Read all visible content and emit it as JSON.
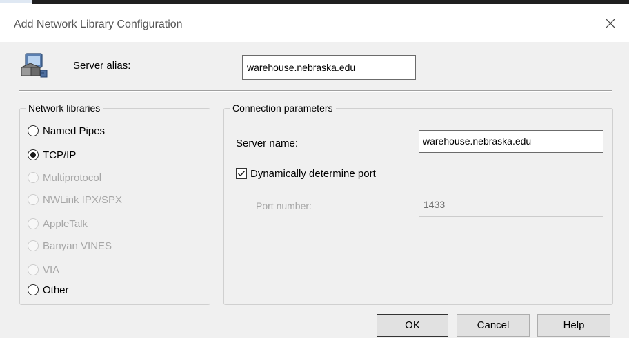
{
  "window": {
    "title": "Add Network Library Configuration",
    "close_icon": "close-icon"
  },
  "alias": {
    "icon": "server-network-icon",
    "label": "Server alias:",
    "value": "warehouse.nebraska.edu"
  },
  "network_libraries": {
    "title": "Network libraries",
    "options": [
      {
        "label": "Named Pipes",
        "checked": false,
        "enabled": true
      },
      {
        "label": "TCP/IP",
        "checked": true,
        "enabled": true
      },
      {
        "label": "Multiprotocol",
        "checked": false,
        "enabled": false
      },
      {
        "label": "NWLink IPX/SPX",
        "checked": false,
        "enabled": false
      },
      {
        "label": "AppleTalk",
        "checked": false,
        "enabled": false
      },
      {
        "label": "Banyan VINES",
        "checked": false,
        "enabled": false
      },
      {
        "label": "VIA",
        "checked": false,
        "enabled": false
      },
      {
        "label": "Other",
        "checked": false,
        "enabled": true
      }
    ]
  },
  "connection": {
    "title": "Connection parameters",
    "server_name_label": "Server name:",
    "server_name_value": "warehouse.nebraska.edu",
    "dynamic_port_label": "Dynamically determine port",
    "dynamic_port_checked": true,
    "port_label": "Port number:",
    "port_value": "1433"
  },
  "buttons": {
    "ok": "OK",
    "cancel": "Cancel",
    "help": "Help"
  }
}
